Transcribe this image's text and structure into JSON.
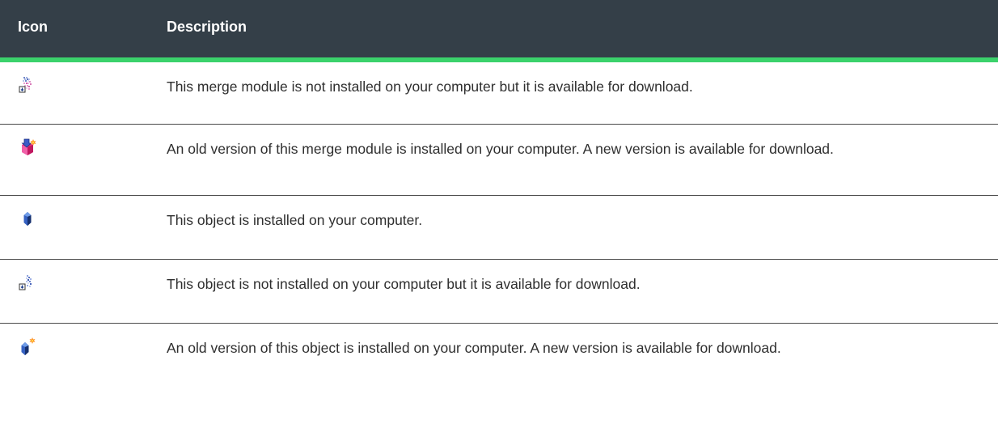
{
  "table": {
    "headers": {
      "icon": "Icon",
      "description": "Description"
    },
    "rows": [
      {
        "icon": "merge-module-available-for-download-icon",
        "description": "This merge module is not installed on your computer but it is available for download."
      },
      {
        "icon": "merge-module-update-available-icon",
        "description": "An old version of this merge module is installed on your computer. A new version is available for download."
      },
      {
        "icon": "object-installed-icon",
        "description": "This object is installed on your computer."
      },
      {
        "icon": "object-available-for-download-icon",
        "description": "This object is not installed on your computer but it is available for download."
      },
      {
        "icon": "object-update-available-icon",
        "description": "An old version of this object is installed on your computer. A new version is available for download."
      }
    ]
  },
  "colors": {
    "header_background": "#343f48",
    "header_accent": "#3bd26b",
    "row_divider": "#4a4a4a"
  }
}
